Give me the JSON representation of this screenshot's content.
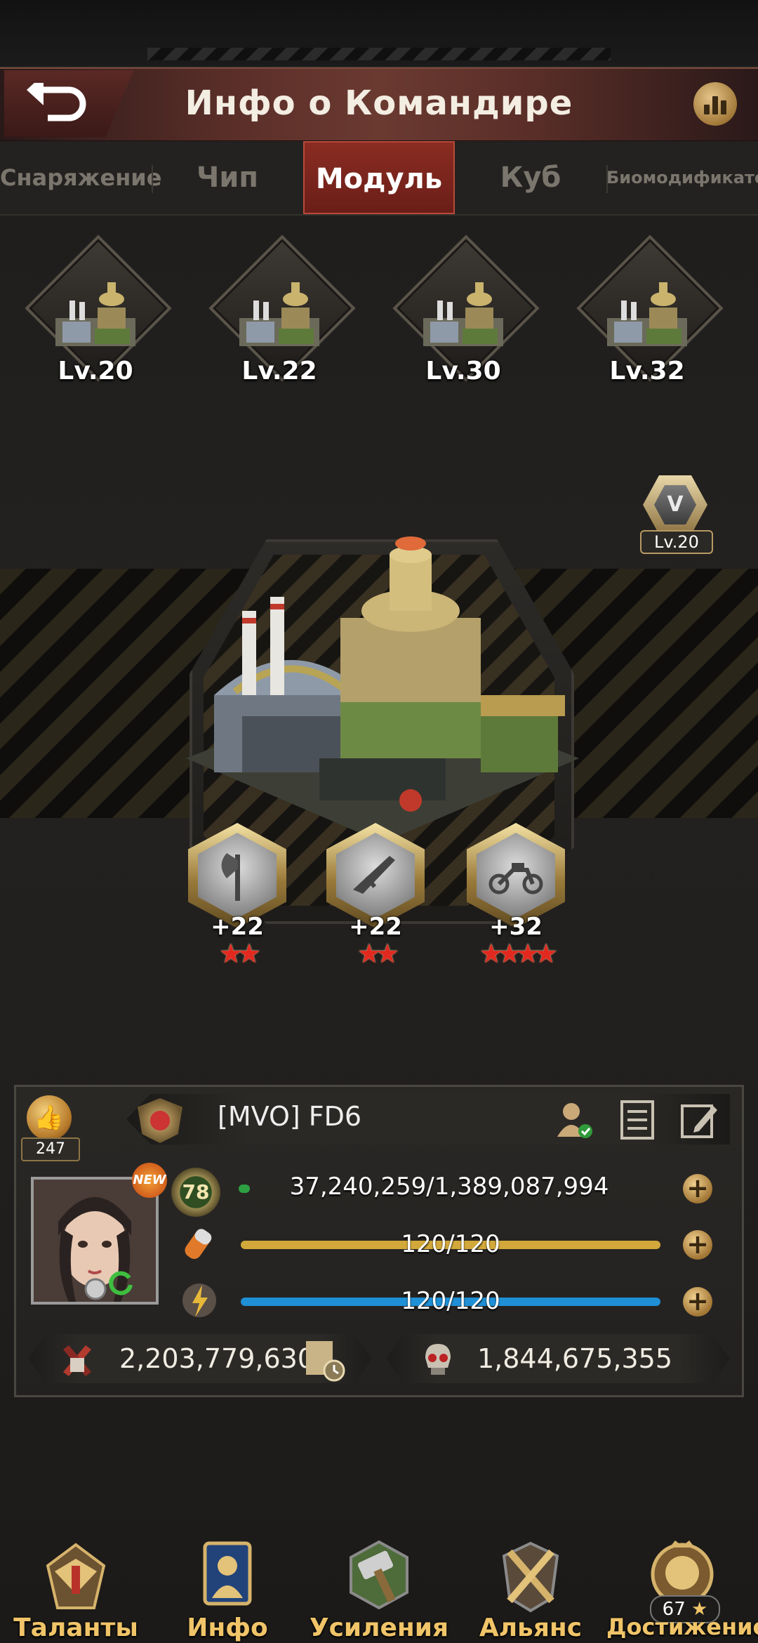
{
  "header": {
    "title": "Инфо о Командире"
  },
  "tabs": [
    {
      "label": "Снаряжение",
      "active": false
    },
    {
      "label": "Чип",
      "active": false
    },
    {
      "label": "Модуль",
      "active": true
    },
    {
      "label": "Куб",
      "active": false
    },
    {
      "label": "Биомодификатор",
      "active": false
    }
  ],
  "modules": [
    {
      "level": "Lv.20"
    },
    {
      "level": "Lv.22"
    },
    {
      "level": "Lv.30"
    },
    {
      "level": "Lv.32"
    }
  ],
  "main_module": {
    "badge_level": "Lv.20"
  },
  "skills": [
    {
      "icon": "axe-icon",
      "value": "+22",
      "stars": 2
    },
    {
      "icon": "rifle-icon",
      "value": "+22",
      "stars": 2
    },
    {
      "icon": "motorcycle-icon",
      "value": "+32",
      "stars": 4
    }
  ],
  "commander": {
    "likes": "247",
    "name": "[MVO]  FD6",
    "level": "78",
    "new_badge": "NEW",
    "exp_text": "37,240,259/1,389,087,994",
    "exp_fraction": 0.027,
    "stamina_text": "120/120",
    "stamina_fraction": 1.0,
    "energy_text": "120/120",
    "energy_fraction": 1.0,
    "power": "2,203,779,630",
    "kills": "1,844,675,355"
  },
  "nav": [
    {
      "label": "Таланты",
      "icon": "eagle-emblem-icon"
    },
    {
      "label": "Инфо",
      "icon": "commander-card-icon"
    },
    {
      "label": "Усиления",
      "icon": "hammer-icon"
    },
    {
      "label": "Альянс",
      "icon": "crossed-swords-icon"
    },
    {
      "label": "Достижение",
      "icon": "lion-crest-icon",
      "count": "67"
    }
  ],
  "colors": {
    "tab_active": "#8a2c22",
    "exp_bar": "#2ea043",
    "stamina_bar": "#d3a83a",
    "energy_bar": "#1f8fd6",
    "nav_label": "#f0c468"
  }
}
